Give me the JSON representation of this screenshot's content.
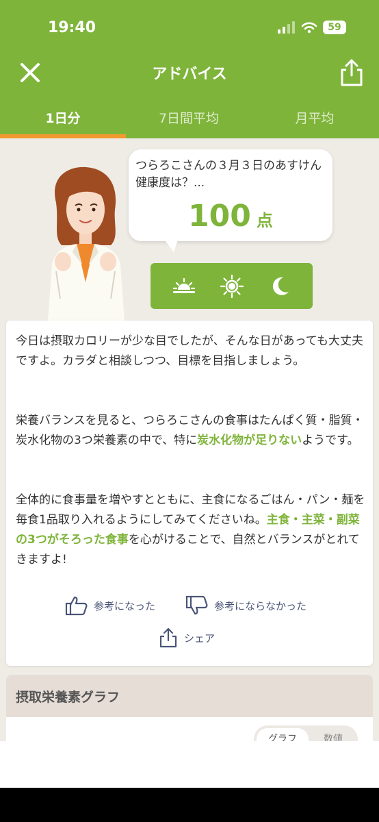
{
  "status": {
    "time": "19:40",
    "battery": "59"
  },
  "header": {
    "title": "アドバイス"
  },
  "tabs": [
    {
      "label": "1日分",
      "active": true
    },
    {
      "label": "7日間平均",
      "active": false
    },
    {
      "label": "月平均",
      "active": false
    }
  ],
  "bubble": {
    "text": "つらろこさんの３月３日のあすけん健康度は？...",
    "score": "100",
    "unit": "点"
  },
  "meals": [
    "breakfast-sunrise-icon",
    "lunch-sun-icon",
    "dinner-moon-icon"
  ],
  "advice": {
    "p1": "今日は摂取カロリーが少な目でしたが、そんな日があっても大丈夫ですよ。カラダと相談しつつ、目標を目指しましょう。",
    "p2_pre": "栄養バランスを見ると、つらろこさんの食事はたんぱく質・脂質・炭水化物の3つ栄養素の中で、特に",
    "p2_hl": "炭水化物が足りない",
    "p2_post": "ようです。",
    "p3_pre": "全体的に食事量を増やすとともに、主食になるごはん・パン・麺を毎食1品取り入れるようにしてみてくださいね。",
    "p3_hl": "主食・主菜・副菜の3つがそろった食事",
    "p3_post": "を心がけることで、自然とバランスがとれてきますよ!"
  },
  "feedback": {
    "helpful": "参考になった",
    "not_helpful": "参考にならなかった",
    "share": "シェア"
  },
  "graph": {
    "title": "摂取栄養素グラフ",
    "seg_graph": "グラフ",
    "seg_values": "数値"
  },
  "colors": {
    "brand_green": "#7fb43b",
    "tab_indicator": "#f29a2e",
    "background": "#efece6"
  }
}
